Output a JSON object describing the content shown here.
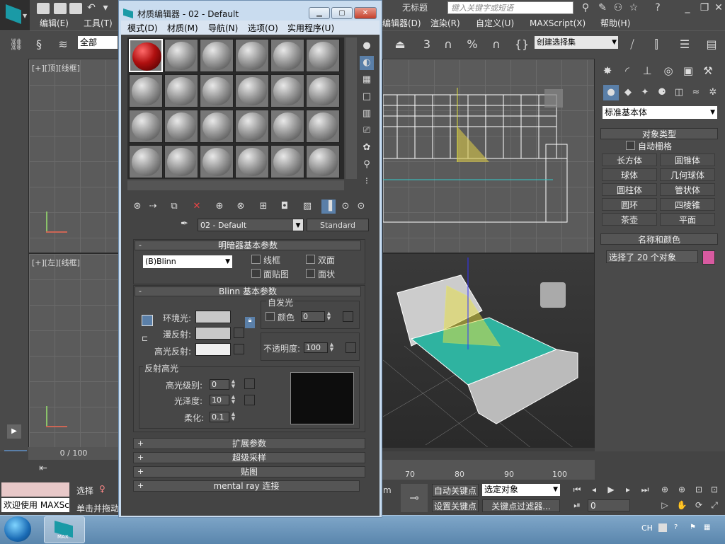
{
  "app": {
    "title_right": "无标题",
    "search_placeholder": "键入关键字或短语",
    "menu": [
      "编辑(E)",
      "工具(T)",
      "编辑器(D)",
      "渲染(R)",
      "自定义(U)",
      "MAXScript(X)",
      "帮助(H)"
    ],
    "filter_value": "全部",
    "selset_value": "创建选择集"
  },
  "viewports": {
    "top_label": "[+][顶][线框]",
    "left_label": "[+][左][线框]"
  },
  "command_panel": {
    "category": "标准基本体",
    "object_type_title": "对象类型",
    "autogrid_label": "自动栅格",
    "objects": [
      "长方体",
      "圆锥体",
      "球体",
      "几何球体",
      "圆柱体",
      "管状体",
      "圆环",
      "四棱锥",
      "茶壶",
      "平面"
    ],
    "name_color_title": "名称和颜色",
    "name_value": "选择了 20 个对象",
    "swatch_color": "#d85aa0"
  },
  "timeline": {
    "frame_text": "0 / 100",
    "ruler_numbers": [
      "70",
      "80",
      "90",
      "100"
    ]
  },
  "status": {
    "prompt_text": "欢迎使用 MAXScr",
    "select_label": "选择",
    "click_label": "单击并拖动",
    "unit_label": "m",
    "auto_key": "自动关键点",
    "set_key": "设置关键点",
    "key_filter_select": "选定对象",
    "key_filters_btn": "关键点过滤器...",
    "frame_value": "0"
  },
  "taskbar": {
    "max_label": "MAX",
    "tray_lang": "CH"
  },
  "material_editor": {
    "title": "材质编辑器 - 02 - Default",
    "menu": [
      "模式(D)",
      "材质(M)",
      "导航(N)",
      "选项(O)",
      "实用程序(U)"
    ],
    "material_name": "02 - Default",
    "material_type": "Standard",
    "shader_basic": {
      "title": "明暗器基本参数",
      "shader_value": "(B)Blinn",
      "wire": "线框",
      "two_sided": "双面",
      "face_map": "面贴图",
      "faceted": "面状"
    },
    "blinn_basic": {
      "title": "Blinn 基本参数",
      "ambient": "环境光:",
      "diffuse": "漫反射:",
      "specular": "高光反射:",
      "self_illum_title": "自发光",
      "color_label": "颜色",
      "self_illum_value": "0",
      "opacity_label": "不透明度:",
      "opacity_value": "100",
      "specular_hl_title": "反射高光",
      "spec_level_label": "高光级别:",
      "spec_level_value": "0",
      "gloss_label": "光泽度:",
      "gloss_value": "10",
      "soften_label": "柔化:",
      "soften_value": "0.1"
    },
    "rollouts": [
      "扩展参数",
      "超级采样",
      "贴图",
      "mental ray 连接"
    ],
    "ambient_color": "#c8c8c8",
    "diffuse_color": "#c8c8c8",
    "specular_color": "#f0f0f0"
  }
}
